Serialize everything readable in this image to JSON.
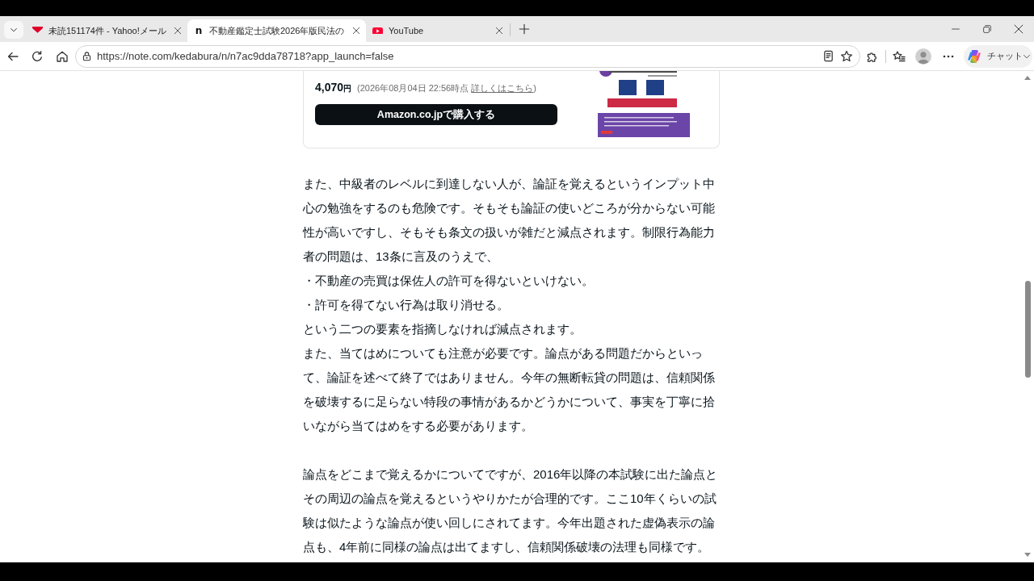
{
  "browser": {
    "tabs": [
      {
        "kind": "mail",
        "title": "未読151174件 - Yahoo!メール",
        "selected": false
      },
      {
        "kind": "letter",
        "favicon": "n",
        "title": "不動産鑑定士試験2026年版民法の",
        "selected": true
      },
      {
        "kind": "video",
        "title": "YouTube",
        "selected": false
      }
    ],
    "address": {
      "url": "https://note.com/kedabura/n/n7ac9dda78718?app_launch=false"
    },
    "chat_button": {
      "label": "チャット"
    }
  },
  "product_card": {
    "price": "4,070",
    "currency": "円",
    "price_note": {
      "before": "(2026年08月04日 22:56時点",
      "link": "詳しくはこちら",
      "after": ")"
    },
    "buy_button": "Amazon.co.jpで購入する"
  },
  "article": {
    "paragraphs": [
      {
        "lines": [
          "また、中級者のレベルに到達しない人が、論証を覚えるというインプット中心の勉強をするのも危険です。そもそも論証の使いどころが分からない可能性が高いですし、そもそも条文の扱いが雑だと減点されます。制限行為能力者の問題は、13条に言及のうえで、",
          "・不動産の売買は保佐人の許可を得ないといけない。",
          "・許可を得てない行為は取り消せる。",
          "という二つの要素を指摘しなければ減点されます。",
          "また、当てはめについても注意が必要です。論点がある問題だからといって、論証を述べて終了ではありません。今年の無断転貸の問題は、信頼関係を破壊するに足らない特段の事情があるかどうかについて、事実を丁寧に拾いながら当てはめをする必要があります。"
        ]
      },
      {
        "lines": [
          "論点をどこまで覚えるかについてですが、2016年以降の本試験に出た論点とその周辺の論点を覚えるというやりかたが合理的です。ここ10年くらいの試験は似たような論点が使い回しにされてます。今年出題された虚偽表示の論点も、4年前に同様の論点は出てますし、信頼関係破壊の法理も同様です。"
        ]
      }
    ]
  }
}
